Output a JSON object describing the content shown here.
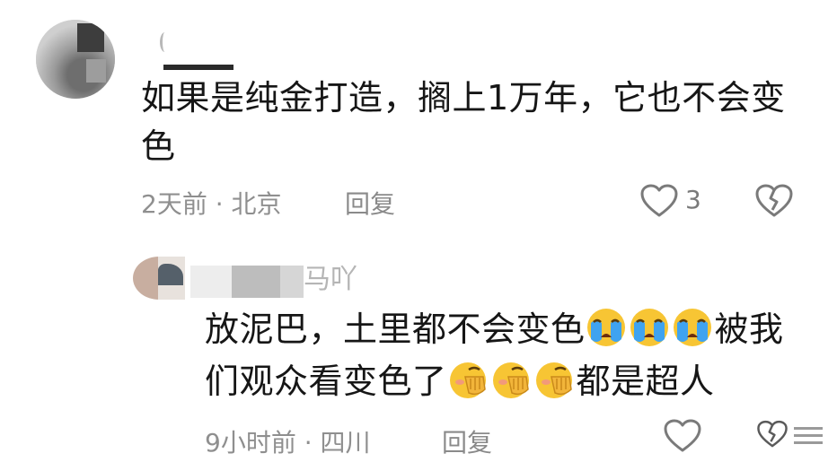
{
  "comments": [
    {
      "username": "",
      "text_line1": "如果是纯金打造，搁上1万年，它也不会变",
      "text_line2": "色",
      "time_location": "2天前 · 北京",
      "reply_label": "回复",
      "like_count": "3",
      "replies": [
        {
          "username_visible": "马吖",
          "text_line1_a": "放泥巴，土里都不会变色",
          "text_line1_emojis": [
            "loudly-crying-face",
            "loudly-crying-face",
            "loudly-crying-face"
          ],
          "text_line1_b": "被我",
          "text_line2_a": "们观众看变色了",
          "text_line2_emojis": [
            "face-palm-shy",
            "face-palm-shy",
            "face-palm-shy"
          ],
          "text_line2_b": "都是超人",
          "time_location": "9小时前 · 四川",
          "reply_label": "回复"
        }
      ]
    }
  ],
  "icons": {
    "like": "heart-outline-icon",
    "dislike": "broken-heart-icon",
    "more": "more-icon"
  },
  "colors": {
    "text": "#161616",
    "meta": "#8f8f8f",
    "icon": "#7a7a7a",
    "emoji_face": "#f7c534"
  }
}
